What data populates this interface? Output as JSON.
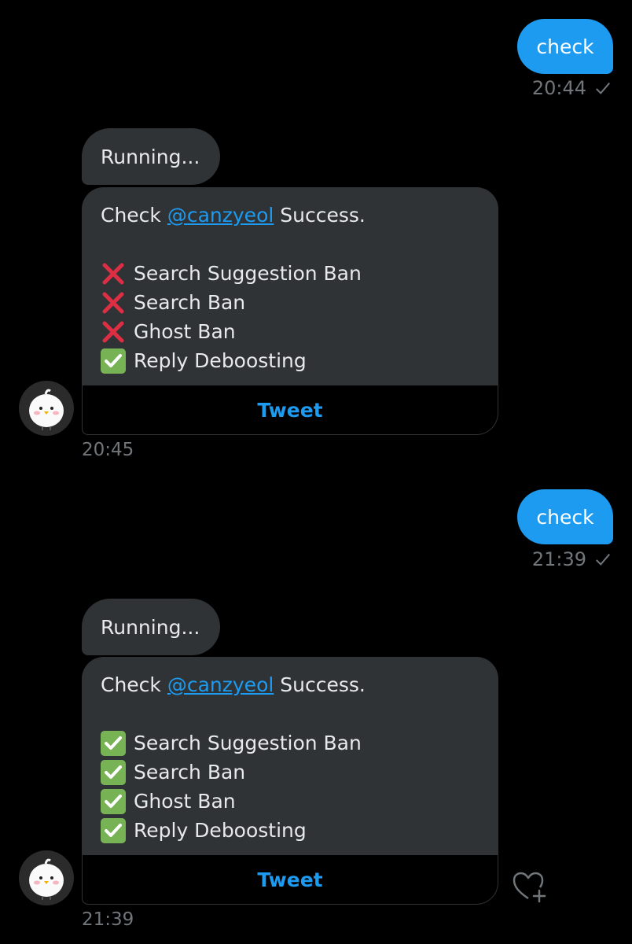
{
  "colors": {
    "accent": "#1d9bf0",
    "bubble": "#2f3336",
    "ok": "#77b255",
    "no": "#dd2e44"
  },
  "messages": [
    {
      "sent": {
        "text": "check",
        "time": "20:44"
      },
      "reply": {
        "running": "Running...",
        "prefix": "Check ",
        "mention": "@canzyeol",
        "suffix": " Success.",
        "items": [
          {
            "status": "fail",
            "icon": "red-cross-icon",
            "label": "Search Suggestion Ban"
          },
          {
            "status": "fail",
            "icon": "red-cross-icon",
            "label": "Search Ban"
          },
          {
            "status": "fail",
            "icon": "red-cross-icon",
            "label": "Ghost Ban"
          },
          {
            "status": "pass",
            "icon": "green-check-icon",
            "label": "Reply Deboosting"
          }
        ],
        "button": "Tweet",
        "time": "20:45"
      }
    },
    {
      "sent": {
        "text": "check",
        "time": "21:39"
      },
      "reply": {
        "running": "Running...",
        "prefix": "Check ",
        "mention": "@canzyeol",
        "suffix": " Success.",
        "items": [
          {
            "status": "pass",
            "icon": "green-check-icon",
            "label": "Search Suggestion Ban"
          },
          {
            "status": "pass",
            "icon": "green-check-icon",
            "label": "Search Ban"
          },
          {
            "status": "pass",
            "icon": "green-check-icon",
            "label": "Ghost Ban"
          },
          {
            "status": "pass",
            "icon": "green-check-icon",
            "label": "Reply Deboosting"
          }
        ],
        "button": "Tweet",
        "time": "21:39"
      }
    }
  ],
  "reaction_icon": "heart-add-icon"
}
